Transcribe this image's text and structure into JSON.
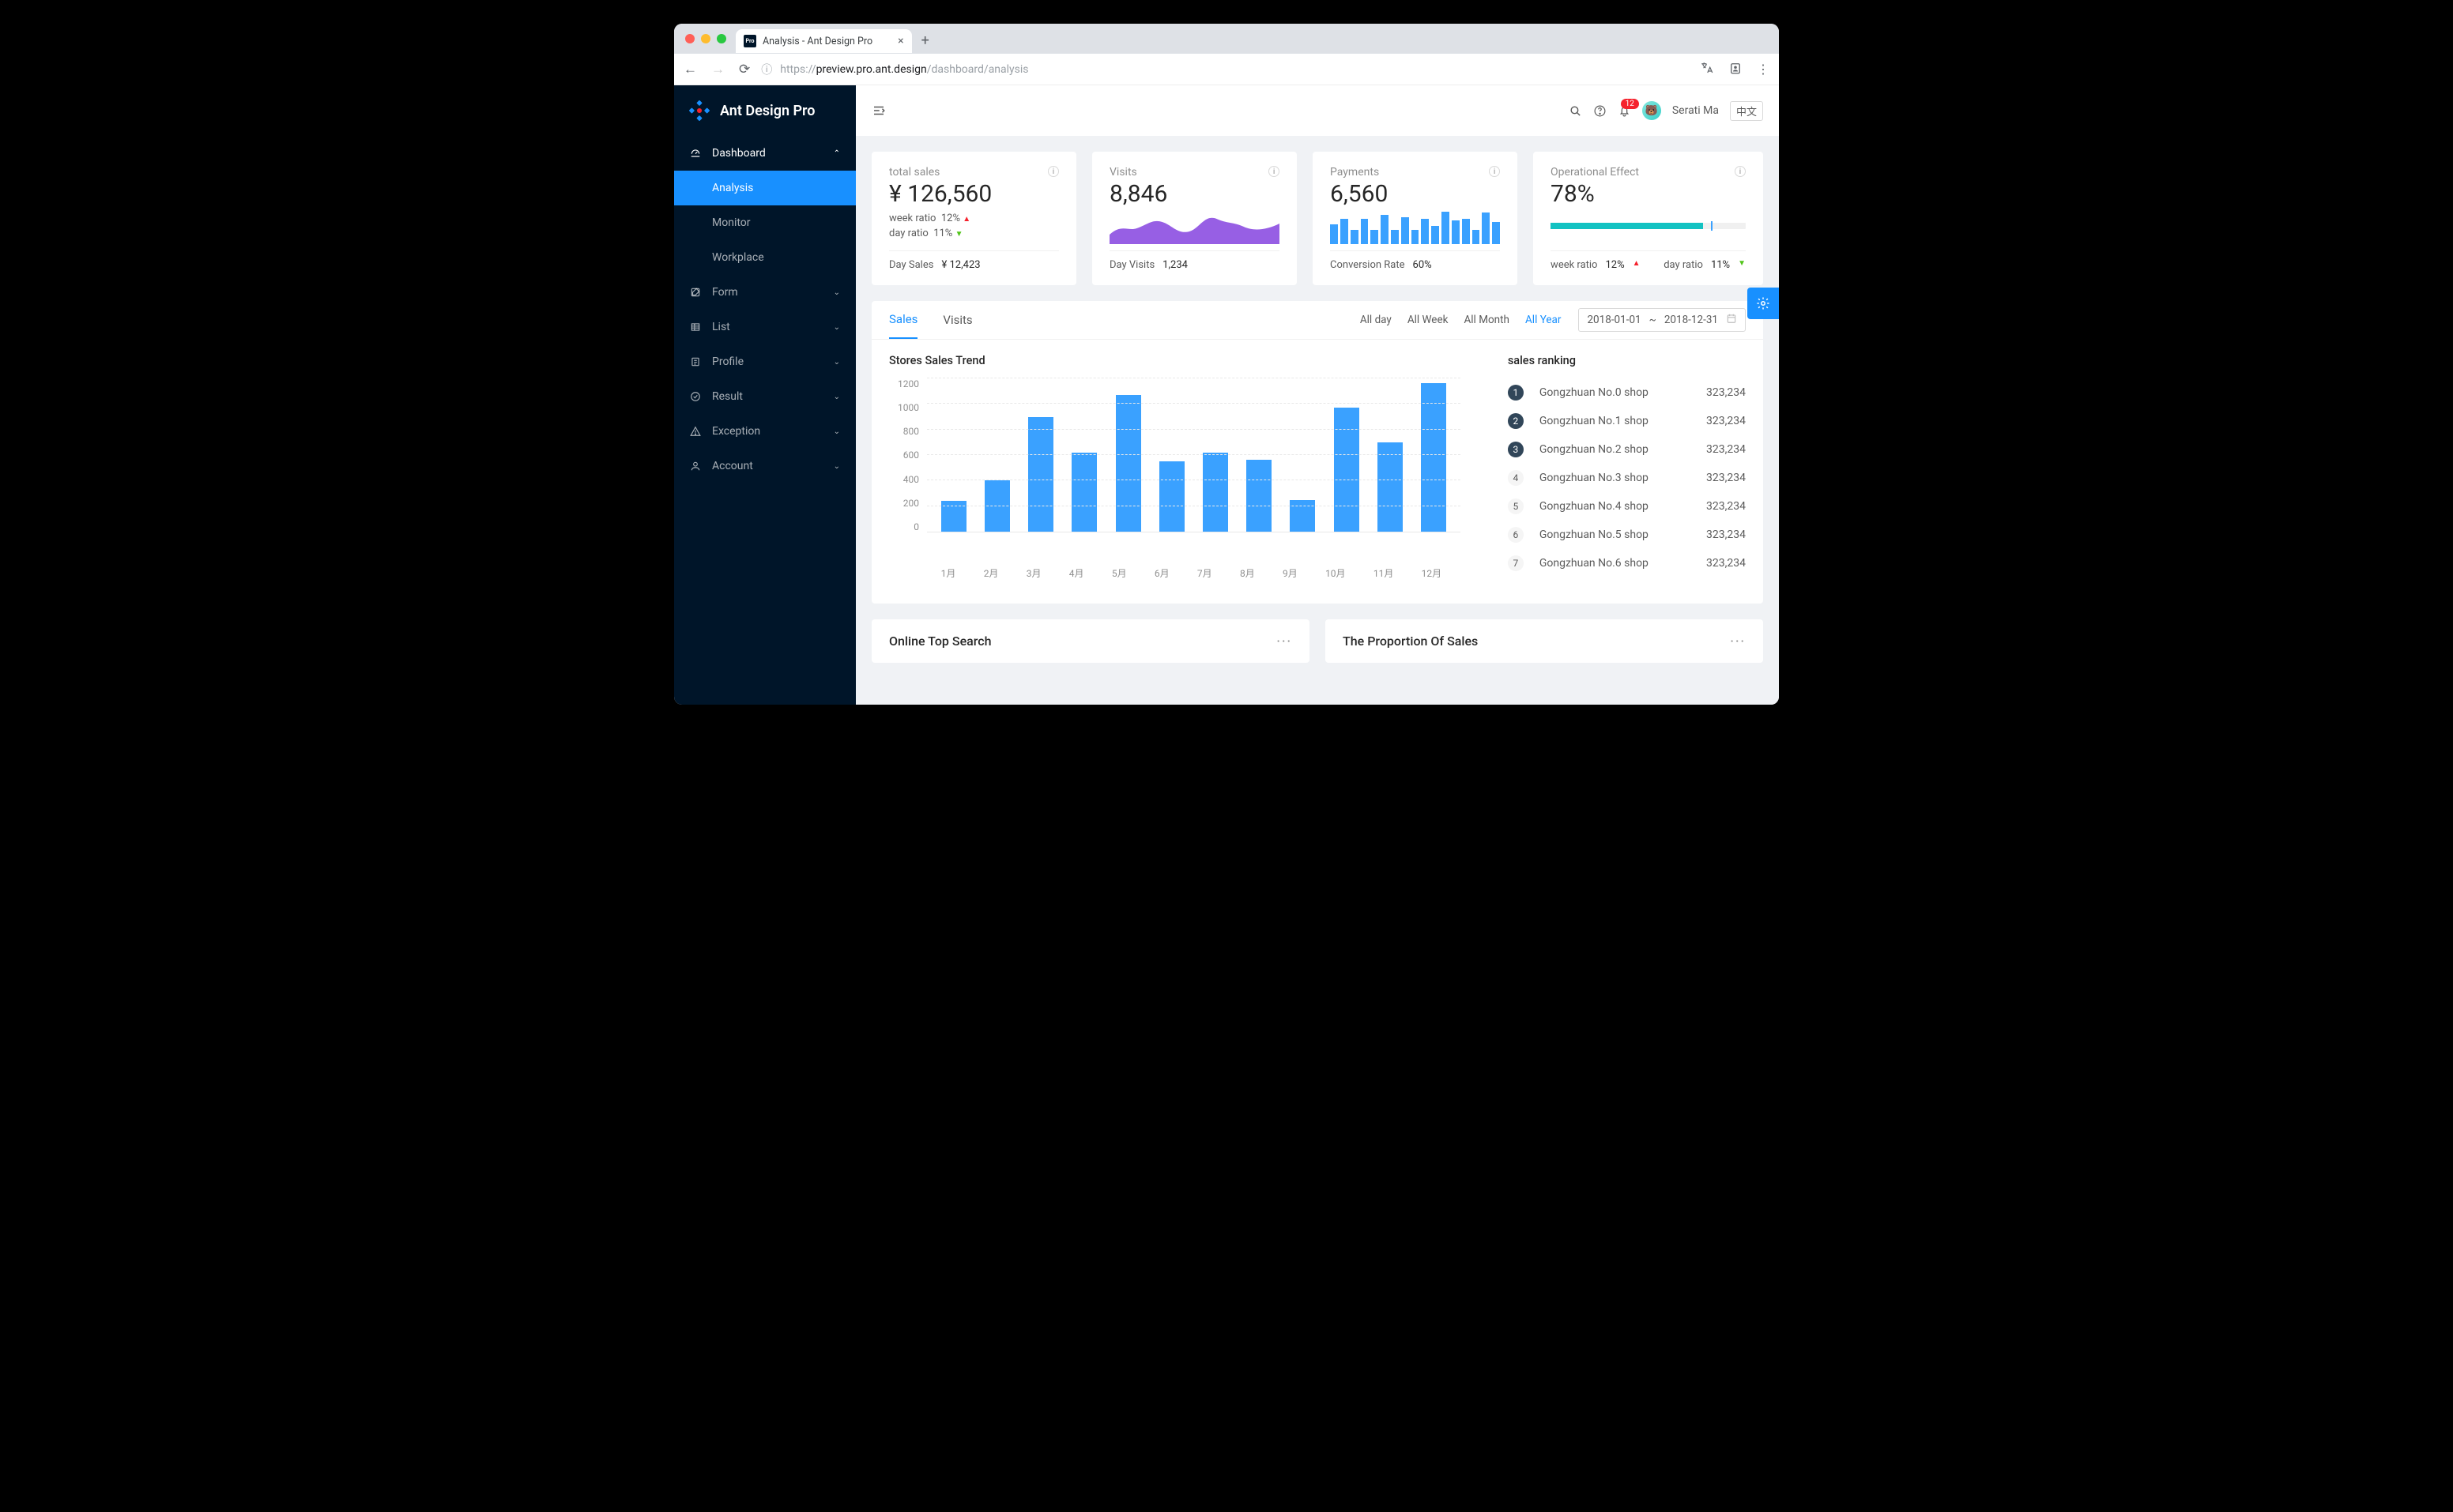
{
  "browser": {
    "tab_title": "Analysis - Ant Design Pro",
    "favicon": "Pro",
    "url_prefix": "https://",
    "url_host": "preview.pro.ant.design",
    "url_path": "/dashboard/analysis"
  },
  "header": {
    "brand": "Ant Design Pro",
    "badge": "12",
    "username": "Serati Ma",
    "lang": "中文"
  },
  "sidebar": {
    "groups": [
      {
        "label": "Dashboard",
        "icon": "dashboard",
        "open": true,
        "children": [
          {
            "label": "Analysis",
            "active": true
          },
          {
            "label": "Monitor"
          },
          {
            "label": "Workplace"
          }
        ]
      },
      {
        "label": "Form",
        "icon": "form"
      },
      {
        "label": "List",
        "icon": "list"
      },
      {
        "label": "Profile",
        "icon": "profile"
      },
      {
        "label": "Result",
        "icon": "result"
      },
      {
        "label": "Exception",
        "icon": "exception"
      },
      {
        "label": "Account",
        "icon": "account"
      }
    ]
  },
  "stats": [
    {
      "title": "total sales",
      "value": "¥ 126,560",
      "mid": [
        {
          "label": "week ratio",
          "pct": "12%",
          "dir": "up"
        },
        {
          "label": "day ratio",
          "pct": "11%",
          "dir": "down"
        }
      ],
      "foot_label": "Day Sales",
      "foot_value": "¥ 12,423"
    },
    {
      "title": "Visits",
      "value": "8,846",
      "chart": "area",
      "foot_label": "Day Visits",
      "foot_value": "1,234"
    },
    {
      "title": "Payments",
      "value": "6,560",
      "chart": "bars",
      "foot_label": "Conversion Rate",
      "foot_value": "60%"
    },
    {
      "title": "Operational Effect",
      "value": "78%",
      "chart": "progress",
      "foot_inline": [
        {
          "label": "week ratio",
          "pct": "12%",
          "dir": "up"
        },
        {
          "label": "day ratio",
          "pct": "11%",
          "dir": "down"
        }
      ]
    }
  ],
  "mini_bar_values": [
    55,
    70,
    40,
    70,
    40,
    80,
    40,
    75,
    40,
    70,
    50,
    90,
    65,
    70,
    40,
    88,
    60
  ],
  "sales": {
    "tabs": [
      "Sales",
      "Visits"
    ],
    "active_tab": "Sales",
    "ranges": [
      "All day",
      "All Week",
      "All Month",
      "All Year"
    ],
    "active_range": "All Year",
    "date_from": "2018-01-01",
    "date_sep": "~",
    "date_to": "2018-12-31",
    "chart_title": "Stores Sales Trend",
    "rank_title": "sales ranking",
    "ranking": [
      {
        "n": 1,
        "name": "Gongzhuan No.0 shop",
        "value": "323,234"
      },
      {
        "n": 2,
        "name": "Gongzhuan No.1 shop",
        "value": "323,234"
      },
      {
        "n": 3,
        "name": "Gongzhuan No.2 shop",
        "value": "323,234"
      },
      {
        "n": 4,
        "name": "Gongzhuan No.3 shop",
        "value": "323,234"
      },
      {
        "n": 5,
        "name": "Gongzhuan No.4 shop",
        "value": "323,234"
      },
      {
        "n": 6,
        "name": "Gongzhuan No.5 shop",
        "value": "323,234"
      },
      {
        "n": 7,
        "name": "Gongzhuan No.6 shop",
        "value": "323,234"
      }
    ]
  },
  "chart_data": {
    "type": "bar",
    "title": "Stores Sales Trend",
    "xlabel": "",
    "ylabel": "",
    "categories": [
      "1月",
      "2月",
      "3月",
      "4月",
      "5月",
      "6月",
      "7月",
      "8月",
      "9月",
      "10月",
      "11月",
      "12月"
    ],
    "values": [
      240,
      400,
      900,
      620,
      1070,
      550,
      620,
      560,
      250,
      970,
      700,
      1160
    ],
    "ylim": [
      0,
      1200
    ],
    "yticks": [
      0,
      200,
      400,
      600,
      800,
      1000,
      1200
    ]
  },
  "lower": {
    "left_title": "Online Top Search",
    "right_title": "The Proportion Of Sales"
  },
  "colors": {
    "primary": "#1890ff",
    "sidebar": "#001529",
    "bar": "#3aa1ff",
    "area": "#975fe4",
    "teal": "#13c2c2",
    "red": "#f5222d",
    "green": "#52c41a"
  }
}
